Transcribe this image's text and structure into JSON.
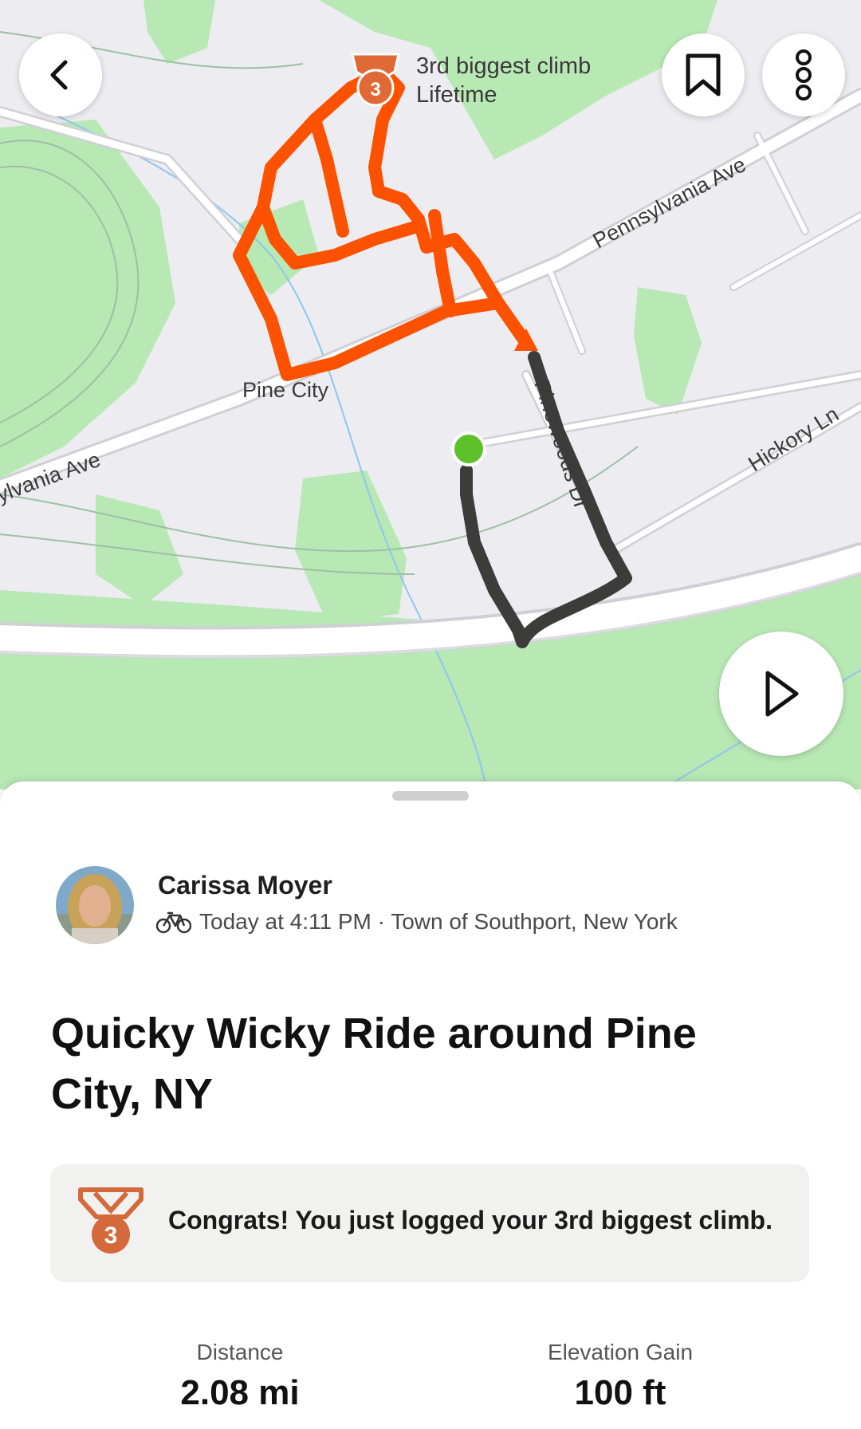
{
  "map": {
    "labels": {
      "pine_city": "Pine City",
      "pennsylvania_ave_right": "Pennsylvania Ave",
      "pennsylvania_ave_left": "ylvania Ave",
      "pinewoods_dr": "Pinewoods Dr",
      "hickory_ln": "Hickory Ln"
    },
    "achievement": {
      "line1": "3rd biggest climb",
      "line2": "Lifetime",
      "rank": "3"
    },
    "colors": {
      "route_achievement": "#fc5200",
      "route_main": "#3c3c3a",
      "start_dot": "#5dc12a",
      "park": "#b8e8b4",
      "land": "#ececf1",
      "road": "#ffffff"
    }
  },
  "controls": {
    "back_icon": "chevron-left-icon",
    "bookmark_icon": "bookmark-icon",
    "more_icon": "more-vertical-icon",
    "play_icon": "play-icon"
  },
  "activity": {
    "athlete_name": "Carissa Moyer",
    "activity_type_icon": "bike-icon",
    "meta": "Today at 4:11 PM · Town of Southport, New York",
    "title": "Quicky Wicky Ride around Pine City, NY",
    "achievement_rank": "3",
    "congrats": "Congrats! You just logged your 3rd biggest climb.",
    "stats": [
      {
        "label": "Distance",
        "value": "2.08 mi"
      },
      {
        "label": "Elevation Gain",
        "value": "100 ft"
      }
    ]
  }
}
